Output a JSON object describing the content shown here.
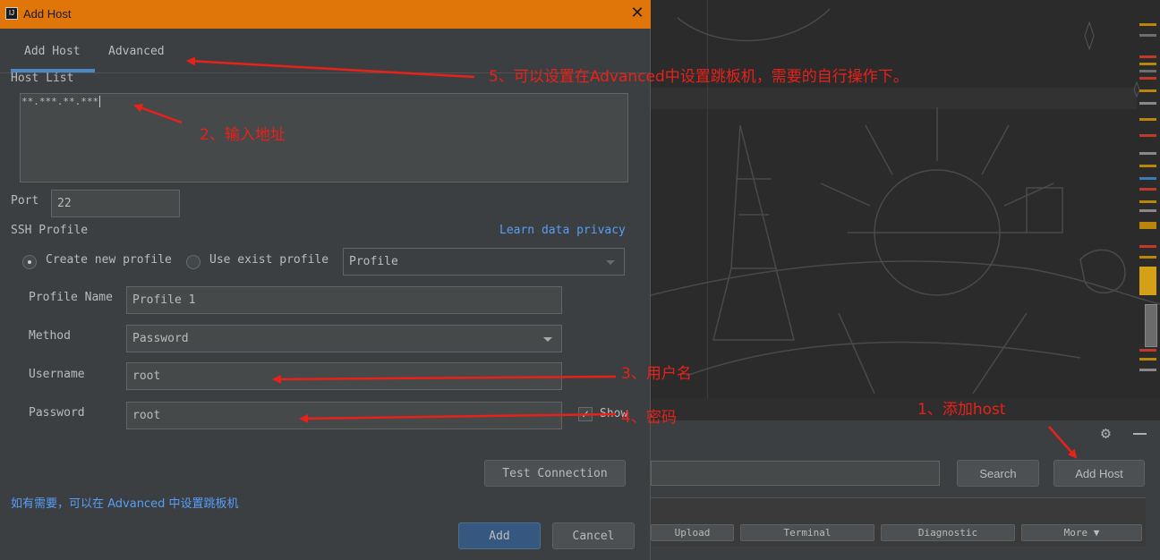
{
  "dialog": {
    "title": "Add Host",
    "close_glyph": "✕",
    "tabs": [
      {
        "label": "Add Host",
        "active": true
      },
      {
        "label": "Advanced",
        "active": false
      }
    ],
    "host_list": {
      "label": "Host List",
      "value": "**.***.**.***"
    },
    "port": {
      "label": "Port",
      "value": "22"
    },
    "ssh_profile": {
      "label": "SSH Profile",
      "privacy_link": "Learn data privacy",
      "create_new": {
        "label": "Create new profile",
        "checked": true
      },
      "use_exist": {
        "label": "Use exist profile",
        "checked": false
      },
      "profile_select": "Profile"
    },
    "profile_name": {
      "label": "Profile Name",
      "value": "Profile 1"
    },
    "method": {
      "label": "Method",
      "value": "Password"
    },
    "username": {
      "label": "Username",
      "value": "root"
    },
    "password": {
      "label": "Password",
      "value": "root"
    },
    "show": {
      "label": "Show",
      "checked": true,
      "check_glyph": "✓"
    },
    "test_connection": "Test Connection",
    "hint": "如有需要，可以在 Advanced 中设置跳板机",
    "add_button": "Add",
    "cancel_button": "Cancel"
  },
  "background_panel": {
    "search_button": "Search",
    "add_host_button": "Add Host",
    "gear_glyph": "⚙",
    "tabs": [
      "Upload",
      "Terminal",
      "Diagnostic",
      "More ▼"
    ]
  },
  "annotations": {
    "step1": "1、添加host",
    "step2": "2、输入地址",
    "step3": "3、用户名",
    "step4": "4、密码",
    "step5": "5、可以设置在Advanced中设置跳板机，需要的自行操作下。"
  },
  "colors": {
    "titlebar": "#e0760a",
    "accent_tab": "#4a88c7",
    "link": "#589df6",
    "annotation_red": "#e8211a",
    "primary_button": "#365880"
  }
}
